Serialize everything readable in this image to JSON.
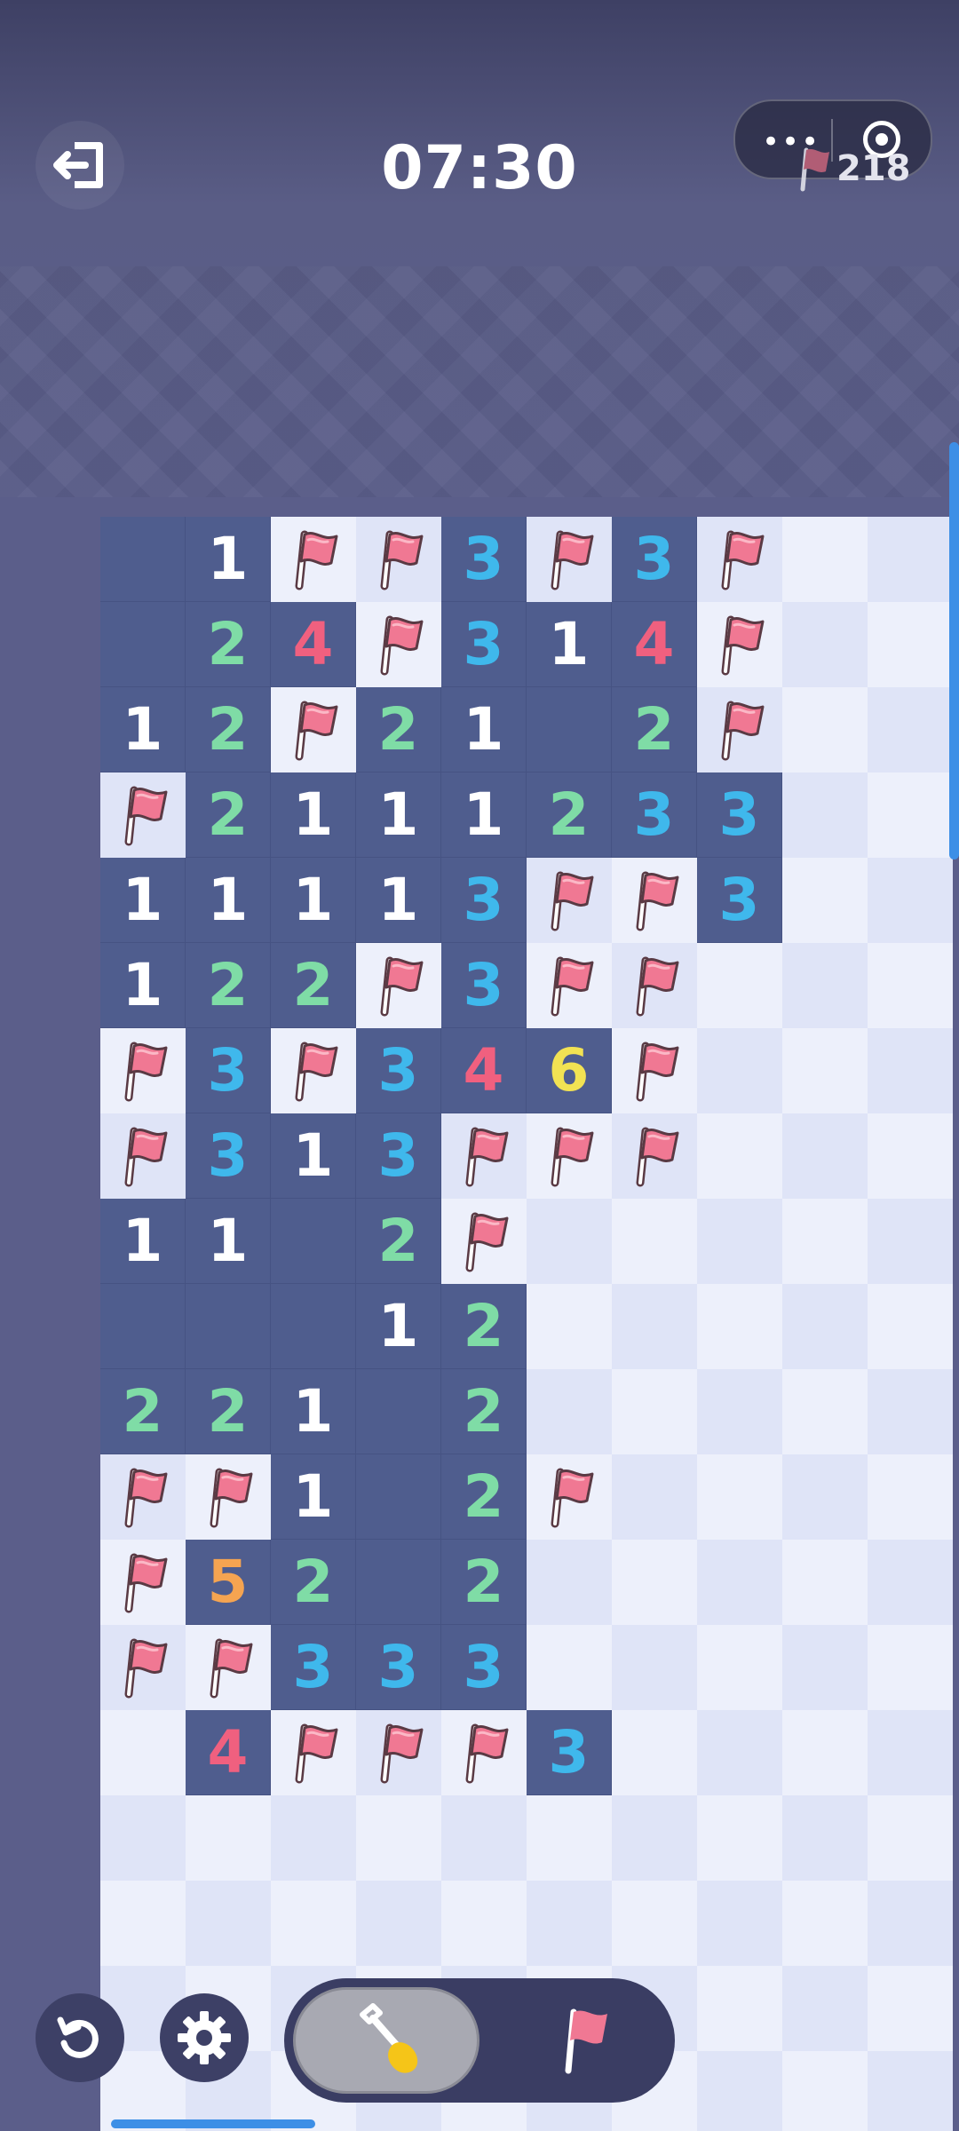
{
  "header": {
    "timer": "07:30",
    "flags_remaining": "218",
    "menu_dots": "•••"
  },
  "icons": {
    "exit": "exit-icon",
    "menu": "more-dots-icon",
    "target": "target-icon",
    "flag": "flag-icon",
    "restart": "restart-icon",
    "settings": "gear-icon",
    "dig": "shovel-icon"
  },
  "modes": {
    "selected": "dig",
    "options": [
      "dig",
      "flag"
    ]
  },
  "board": {
    "rows": [
      [
        "R",
        "1",
        "F",
        "F",
        "3",
        "F",
        "3",
        "F",
        "C",
        "C"
      ],
      [
        "R",
        "2",
        "4",
        "F",
        "3",
        "1",
        "4",
        "F",
        "C",
        "C"
      ],
      [
        "1",
        "2",
        "F",
        "2",
        "1",
        "R",
        "2",
        "F",
        "C",
        "C"
      ],
      [
        "F",
        "2",
        "1",
        "1",
        "1",
        "2",
        "3",
        "3",
        "C",
        "C"
      ],
      [
        "1",
        "1",
        "1",
        "1",
        "3",
        "F",
        "F",
        "3",
        "C",
        "C"
      ],
      [
        "1",
        "2",
        "2",
        "F",
        "3",
        "F",
        "F",
        "C",
        "C",
        "C"
      ],
      [
        "F",
        "3",
        "F",
        "3",
        "4",
        "6",
        "F",
        "C",
        "C",
        "C"
      ],
      [
        "F",
        "3",
        "1",
        "3",
        "F",
        "F",
        "F",
        "C",
        "C",
        "C"
      ],
      [
        "1",
        "1",
        "R",
        "2",
        "F",
        "C",
        "C",
        "C",
        "C",
        "C"
      ],
      [
        "R",
        "R",
        "R",
        "1",
        "2",
        "C",
        "C",
        "C",
        "C",
        "C"
      ],
      [
        "2",
        "2",
        "1",
        "R",
        "2",
        "C",
        "C",
        "C",
        "C",
        "C"
      ],
      [
        "F",
        "F",
        "1",
        "R",
        "2",
        "F",
        "C",
        "C",
        "C",
        "C"
      ],
      [
        "F",
        "5",
        "2",
        "R",
        "2",
        "C",
        "C",
        "C",
        "C",
        "C"
      ],
      [
        "F",
        "F",
        "3",
        "3",
        "3",
        "C",
        "C",
        "C",
        "C",
        "C"
      ],
      [
        "C",
        "4",
        "F",
        "F",
        "F",
        "3",
        "C",
        "C",
        "C",
        "C"
      ],
      [
        "C",
        "C",
        "C",
        "C",
        "C",
        "C",
        "C",
        "C",
        "C",
        "C"
      ],
      [
        "C",
        "C",
        "C",
        "C",
        "C",
        "C",
        "C",
        "C",
        "C",
        "C"
      ],
      [
        "C",
        "C",
        "C",
        "C",
        "C",
        "C",
        "C",
        "C",
        "C",
        "C"
      ],
      [
        "C",
        "C",
        "C",
        "C",
        "C",
        "C",
        "C",
        "C",
        "C",
        "C"
      ]
    ],
    "legend": {
      "R": "revealed-empty",
      "F": "flag",
      "C": "covered"
    }
  },
  "colors": {
    "revealed": "#4f5d8e",
    "covered_light": "#edf0fb",
    "covered_dark": "#dfe4f7",
    "flag_red": "#f07893",
    "n1": "#ffffff",
    "n2": "#7fdca6",
    "n3": "#3fb8ec",
    "n4": "#f0607f",
    "n5": "#f5a451",
    "n6": "#f2e253"
  }
}
